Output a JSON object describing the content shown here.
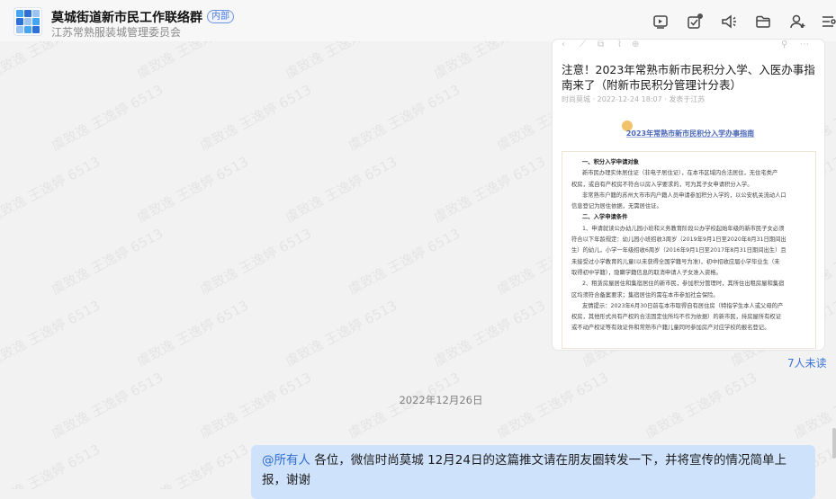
{
  "header": {
    "group_name": "莫城街道新市民工作联络群",
    "inner_badge": "内部",
    "subtitle": "江苏常熟服装城管理委员会",
    "icons": [
      "screen-share-icon",
      "task-check-icon",
      "announcement-icon",
      "folder-icon",
      "add-member-icon",
      "more-settings-icon"
    ]
  },
  "watermark": "虞致逸 王逸婷 6513",
  "article": {
    "toolbar_icons": [
      "back-icon",
      "share-icon",
      "copy-icon",
      "link-icon",
      "globe-icon",
      "pin-icon",
      "more-icon"
    ],
    "title": "注意！2023年常熟市新市民积分入学、入医办事指南来了（附新市民积分管理计分表）",
    "meta": "时尚莫城 · 2022-12-24 18:07 · 发表于江苏",
    "banner": "2023年常熟市新市民积分入学办事指南",
    "lines": [
      {
        "text": "一、积分入学申请对象",
        "heading": true
      },
      {
        "text": "新市民办理实体居住证（非电子居住证），在本市区域内合法居住，无住宅类产",
        "heading": false
      },
      {
        "text": "权房，或自有产权房不符合以房入学要求的，可为其子女申请积分入学。",
        "heading": false
      },
      {
        "text": "非常熟市户籍的苏州大市市内户籍人员申请参加积分入学的，以公安机关流动人口",
        "heading": false
      },
      {
        "text": "信息登记为居住依据，无需居住证。",
        "heading": false
      },
      {
        "text": "二、入学申请条件",
        "heading": true
      },
      {
        "text": "1、申请就读公办幼儿园小班和义务教育阶段公办学校起始年级的新市民子女必须",
        "heading": false
      },
      {
        "text": "符合以下年龄规定：幼儿园小班招收3周岁（2019年9月1日至2020年8月31日期间出",
        "heading": false
      },
      {
        "text": "生）的幼儿，小学一年级招收6周岁（2016年9月1日至2017年8月31日期间出生）且",
        "heading": false
      },
      {
        "text": "未接受过小学教育的儿童(以未获得全国学籍号为准)，初中招收应届小学毕业生（未",
        "heading": false
      },
      {
        "text": "取得初中学籍），隐瞒学籍信息的取消申请人子女准入资格。",
        "heading": false
      },
      {
        "text": "2、租赁房屋居住和集宿居住的新市民，参加积分管理时，其所住出租房屋和集宿",
        "heading": false
      },
      {
        "text": "区均须符合备案要求；集宿居住的需在本市参加社会保险。",
        "heading": false
      },
      {
        "text": "友情提示：2023年6月30日前在本市取得自有居住房（特指学生本人或父母的产",
        "heading": false
      },
      {
        "text": "权房，其他形式共有产权的合法固定住所均不作为依据）的新市民，持房屋所有权证",
        "heading": false
      },
      {
        "text": "或不动产权证等有效证件和常熟市户籍儿童同时参加房产对应学校的报名登记。",
        "heading": false
      }
    ],
    "unread": "7人未读"
  },
  "date_separator": "2022年12月26日",
  "message": {
    "mention": "@所有人",
    "text": " 各位，微信时尚莫城 12月24日的这篇推文请在朋友圈转发一下，并将宣传的情况简单上报，谢谢"
  }
}
